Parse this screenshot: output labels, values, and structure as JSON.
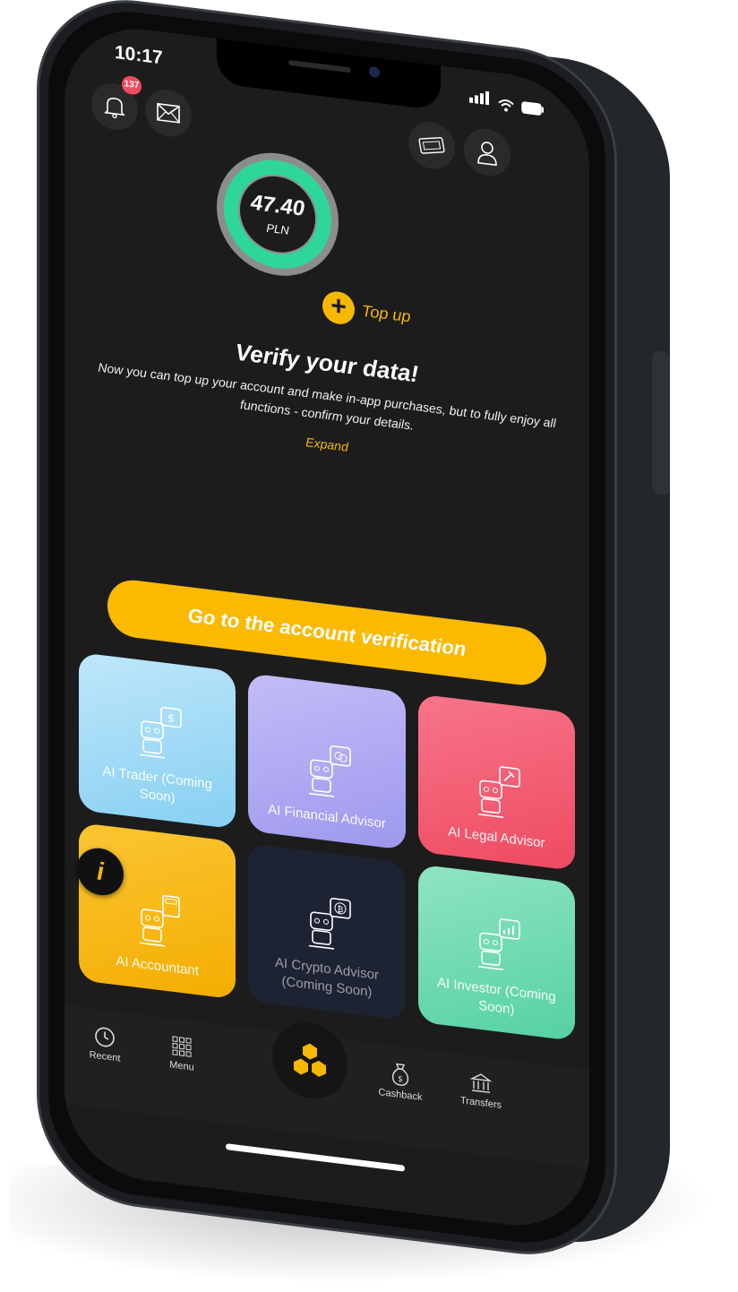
{
  "status_bar": {
    "time": "10:17"
  },
  "header": {
    "notifications_count": "137"
  },
  "balance": {
    "amount": "47.40",
    "currency": "PLN",
    "topup_label": "Top up"
  },
  "verify": {
    "title": "Verify your data!",
    "text": "Now you can top up your account and make in-app purchases, but to fully enjoy all functions - confirm your details.",
    "expand_label": "Expand",
    "cta_label": "Go to the account verification"
  },
  "tiles": [
    {
      "label": "AI Trader (Coming Soon)",
      "color": "#9fd9f5"
    },
    {
      "label": "AI Financial Advisor",
      "color": "#a9a4f0"
    },
    {
      "label": "AI Legal Advisor",
      "color": "#f2576d"
    },
    {
      "label": "AI Accountant",
      "color": "#f7b500"
    },
    {
      "label": "AI Crypto Advisor (Coming Soon)",
      "color": "#1d2333"
    },
    {
      "label": "AI Investor (Coming Soon)",
      "color": "#66d8ae"
    }
  ],
  "tabbar": {
    "recent": "Recent",
    "menu": "Menu",
    "cashback": "Cashback",
    "transfers": "Transfers"
  },
  "colors": {
    "accent": "#f6b800",
    "ring": "#2fd69a",
    "badge": "#ef4b5f"
  }
}
